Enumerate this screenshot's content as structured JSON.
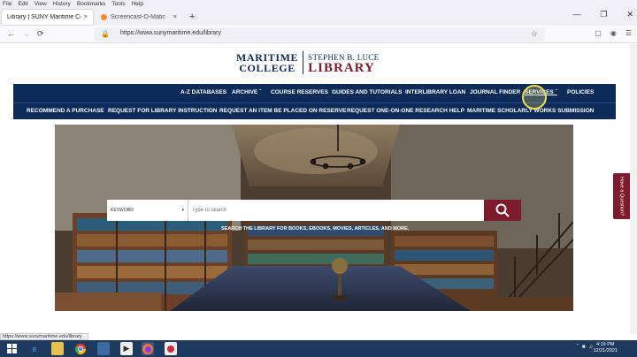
{
  "menubar": [
    "File",
    "Edit",
    "View",
    "History",
    "Bookmarks",
    "Tools",
    "Help"
  ],
  "tabs": [
    {
      "title": "Library | SUNY Maritime College",
      "close": "×"
    },
    {
      "title": "Screencast-O-Matic",
      "close": "×"
    }
  ],
  "new_tab": "+",
  "window_controls": [
    "—",
    "❐",
    "✕"
  ],
  "nav": {
    "back": "←",
    "forward": "→",
    "reload": "⟳"
  },
  "url": "https://www.sunymaritime.edu/library",
  "logo": {
    "line1": "MARITIME",
    "line2": "COLLEGE",
    "line3": "STEPHEN B. LUCE",
    "line4": "LIBRARY"
  },
  "nav_primary": [
    "A-Z DATABASES",
    "ARCHIVE",
    "COURSE RESERVES",
    "GUIDES AND TUTORIALS",
    "INTERLIBRARY LOAN",
    "JOURNAL FINDER",
    "SERVICES",
    "POLICIES"
  ],
  "nav_secondary": [
    "RECOMMEND A PURCHASE",
    "REQUEST FOR LIBRARY INSTRUCTION",
    "REQUEST AN ITEM BE PLACED ON RESERVE",
    "REQUEST ONE-ON-ONE RESEARCH HELP",
    "MARITIME SCHOLARLY WORKS SUBMISSION"
  ],
  "search": {
    "select_value": "KEYWORD",
    "placeholder": "Type to search",
    "tagline": "SEARCH THE LIBRARY FOR BOOKS, EBOOKS, MOVIES, ARTICLES, AND MORE."
  },
  "question_tab": "Have a Question?",
  "status_url": "https://www.sunymaritime.edu/library",
  "clock": {
    "time": "4:19 PM",
    "date": "12/21/2021"
  },
  "colors": {
    "navy": "#0c2b59",
    "maroon": "#7d1a2c"
  }
}
